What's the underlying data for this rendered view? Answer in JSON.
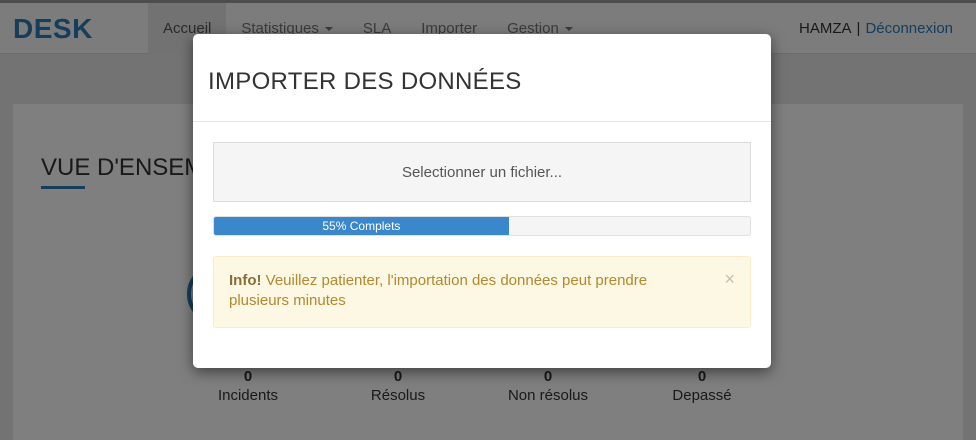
{
  "navbar": {
    "brand": "DESK",
    "items": [
      {
        "label": "Accueil",
        "active": true,
        "dropdown": false
      },
      {
        "label": "Statistiques",
        "active": false,
        "dropdown": true
      },
      {
        "label": "SLA",
        "active": false,
        "dropdown": false
      },
      {
        "label": "Importer",
        "active": false,
        "dropdown": false
      },
      {
        "label": "Gestion",
        "active": false,
        "dropdown": true
      }
    ],
    "user": "HAMZA",
    "separator": "|",
    "logout": "Déconnexion"
  },
  "page": {
    "overview_title": "VUE D'ENSEMBLE",
    "stats": [
      {
        "value": "0",
        "label": "Incidents"
      },
      {
        "value": "0",
        "label": "Résolus"
      },
      {
        "value": "0",
        "label": "Non résolus"
      },
      {
        "value": "0",
        "label": "Depassé"
      }
    ]
  },
  "modal": {
    "title": "IMPORTER DES DONNÉES",
    "file_button": "Selectionner un fichier...",
    "progress": {
      "percent": 55,
      "label": "55% Complets"
    },
    "alert": {
      "strong": "Info!",
      "text": " Veuillez patienter, l'importation des données peut prendre plusieurs minutes",
      "close": "×"
    }
  },
  "colors": {
    "brand": "#2a7ab8",
    "progress": "#3a87cc",
    "alert_bg": "#fcf8e3",
    "alert_text": "#b3882e"
  }
}
